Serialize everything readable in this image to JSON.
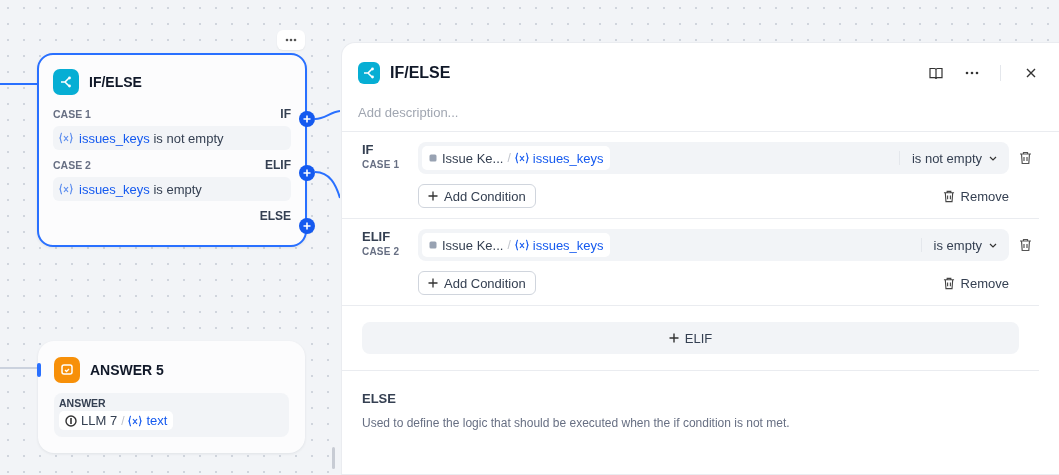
{
  "canvas": {
    "nodes": [
      {
        "kind": "ifelse",
        "title": "IF/ELSE",
        "selected": true,
        "cases": [
          {
            "label": "CASE 1",
            "branch": "IF",
            "variable": "issues_keys",
            "operator": "is not empty"
          },
          {
            "label": "CASE 2",
            "branch": "ELIF",
            "variable": "issues_keys",
            "operator": "is empty"
          }
        ],
        "else_label": "ELSE"
      },
      {
        "kind": "answer",
        "title": "ANSWER 5",
        "selected": false,
        "field_label": "ANSWER",
        "source": "LLM 7",
        "separator": "/",
        "variable": "text"
      }
    ]
  },
  "panel": {
    "title": "IF/ELSE",
    "description": {
      "placeholder": "Add description..."
    },
    "cases": [
      {
        "branch": "IF",
        "label": "CASE 1",
        "conditions": [
          {
            "node": "Issue Ke...",
            "separator": "/",
            "variable": "issues_keys",
            "operator": "is not empty"
          }
        ],
        "add_label": "Add Condition",
        "remove_label": "Remove"
      },
      {
        "branch": "ELIF",
        "label": "CASE 2",
        "conditions": [
          {
            "node": "Issue Ke...",
            "separator": "/",
            "variable": "issues_keys",
            "operator": "is empty"
          }
        ],
        "add_label": "Add Condition",
        "remove_label": "Remove"
      }
    ],
    "add_elif": "ELIF",
    "else": {
      "title": "ELSE",
      "description": "Used to define the logic that should be executed when the if condition is not met."
    }
  }
}
